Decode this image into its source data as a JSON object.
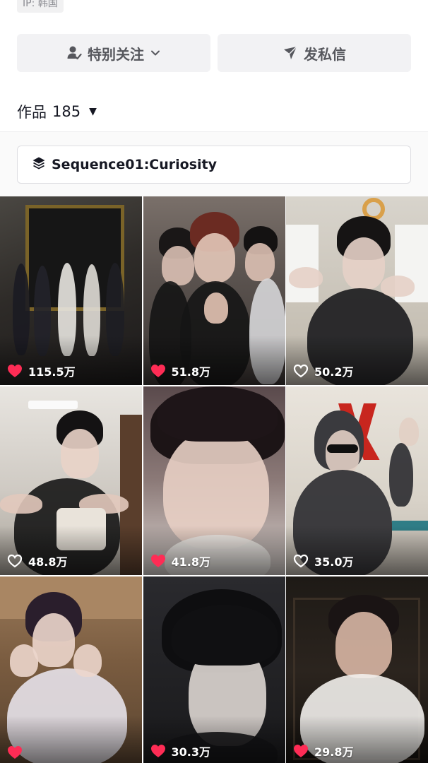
{
  "profile": {
    "ip_label": "IP: 韩国"
  },
  "actions": {
    "follow_label": "特别关注",
    "message_label": "发私信"
  },
  "works": {
    "label": "作品",
    "count": "185"
  },
  "collection": {
    "title": "Sequence01:Curiosity"
  },
  "videos": [
    {
      "likes": "115.5万",
      "liked": true,
      "icon": "heart-filled-icon"
    },
    {
      "likes": "51.8万",
      "liked": true,
      "icon": "heart-filled-icon"
    },
    {
      "likes": "50.2万",
      "liked": false,
      "icon": "heart-outline-icon"
    },
    {
      "likes": "48.8万",
      "liked": false,
      "icon": "heart-outline-icon"
    },
    {
      "likes": "41.8万",
      "liked": true,
      "icon": "heart-filled-icon"
    },
    {
      "likes": "35.0万",
      "liked": false,
      "icon": "heart-outline-icon"
    },
    {
      "likes": "",
      "liked": true,
      "icon": "heart-filled-icon"
    },
    {
      "likes": "30.3万",
      "liked": true,
      "icon": "heart-filled-icon"
    },
    {
      "likes": "29.8万",
      "liked": true,
      "icon": "heart-filled-icon"
    }
  ],
  "colors": {
    "heart_red": "#fe2c55",
    "button_bg": "#f2f2f4"
  }
}
